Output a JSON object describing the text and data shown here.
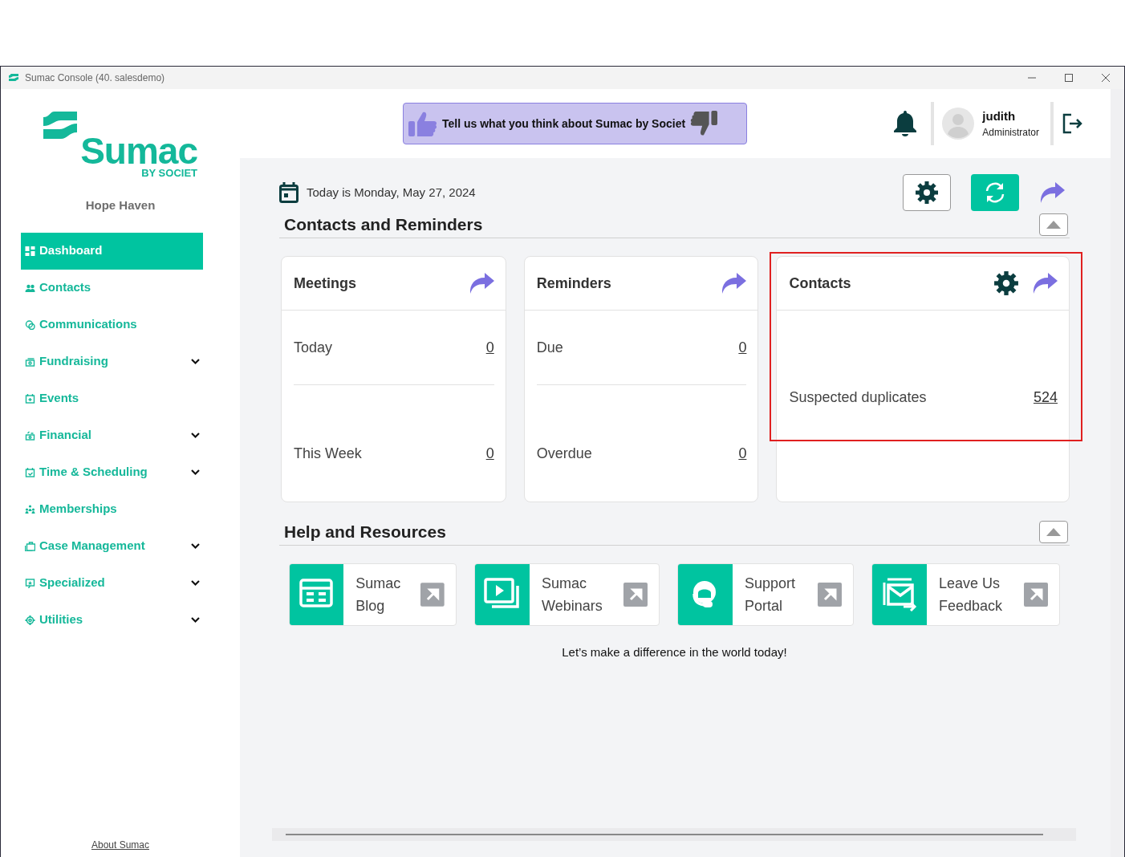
{
  "window": {
    "title": "Sumac Console (40. salesdemo)"
  },
  "sidebar": {
    "wordmark": "Sumac",
    "tagline": "BY SOCIET",
    "organization": "Hope Haven",
    "items": [
      {
        "label": "Dashboard",
        "selected": true,
        "has_submenu": false
      },
      {
        "label": "Contacts",
        "selected": false,
        "has_submenu": false
      },
      {
        "label": "Communications",
        "selected": false,
        "has_submenu": false
      },
      {
        "label": "Fundraising",
        "selected": false,
        "has_submenu": true
      },
      {
        "label": "Events",
        "selected": false,
        "has_submenu": false
      },
      {
        "label": "Financial",
        "selected": false,
        "has_submenu": true
      },
      {
        "label": "Time & Scheduling",
        "selected": false,
        "has_submenu": true
      },
      {
        "label": "Memberships",
        "selected": false,
        "has_submenu": false
      },
      {
        "label": "Case Management",
        "selected": false,
        "has_submenu": true
      },
      {
        "label": "Specialized",
        "selected": false,
        "has_submenu": true
      },
      {
        "label": "Utilities",
        "selected": false,
        "has_submenu": true
      }
    ],
    "footer_link": "About Sumac"
  },
  "header": {
    "feedback_banner": "Tell us what you think about Sumac by Societ",
    "user": {
      "name": "judith",
      "role": "Administrator"
    }
  },
  "date_text": "Today is Monday, May 27, 2024",
  "contacts_section": {
    "title": "Contacts and Reminders",
    "expanded": true,
    "cards": [
      {
        "title": "Meetings",
        "has_settings": false,
        "highlighted": false,
        "rows": [
          {
            "label": "Today",
            "value": "0"
          },
          {
            "label": "This Week",
            "value": "0"
          }
        ]
      },
      {
        "title": "Reminders",
        "has_settings": false,
        "highlighted": false,
        "rows": [
          {
            "label": "Due",
            "value": "0"
          },
          {
            "label": "Overdue",
            "value": "0"
          }
        ]
      },
      {
        "title": "Contacts",
        "has_settings": true,
        "highlighted": true,
        "rows": [
          {
            "label": "Suspected duplicates",
            "value": "524"
          }
        ]
      }
    ]
  },
  "help_section": {
    "title": "Help and Resources",
    "expanded": true,
    "resources": [
      {
        "label": "Sumac Blog"
      },
      {
        "label": "Sumac Webinars"
      },
      {
        "label": "Support Portal"
      },
      {
        "label": "Leave Us Feedback"
      }
    ]
  },
  "footer_text": "Let’s make a difference in the world today!"
}
